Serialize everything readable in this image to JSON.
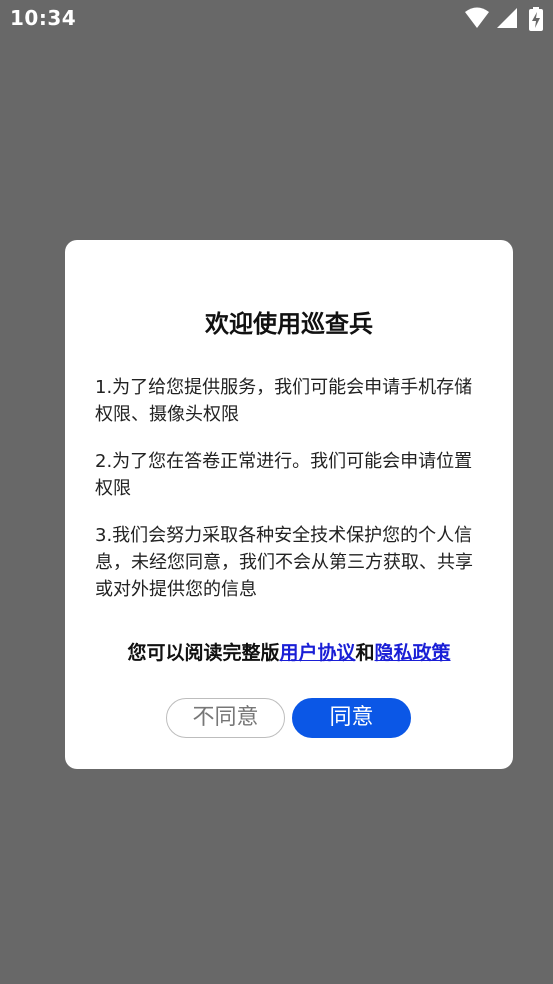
{
  "status_bar": {
    "time": "10:34",
    "icons": [
      "wifi-icon",
      "signal-icon",
      "battery-charging-icon"
    ]
  },
  "dialog": {
    "title": "欢迎使用巡查兵",
    "paragraphs": [
      "1.为了给您提供服务，我们可能会申请手机存储权限、摄像头权限",
      "2.为了您在答卷正常进行。我们可能会申请位置权限",
      "3.我们会努力采取各种安全技术保护您的个人信息，未经您同意，我们不会从第三方获取、共享或对外提供您的信息"
    ],
    "read_prefix": "您可以阅读完整版",
    "user_agreement_link": "用户协议",
    "conjunction": "和",
    "privacy_policy_link": "隐私政策",
    "disagree_label": "不同意",
    "agree_label": "同意"
  },
  "colors": {
    "overlay": "#686868",
    "accent": "#0b57e6",
    "link": "#1a1fd6"
  }
}
